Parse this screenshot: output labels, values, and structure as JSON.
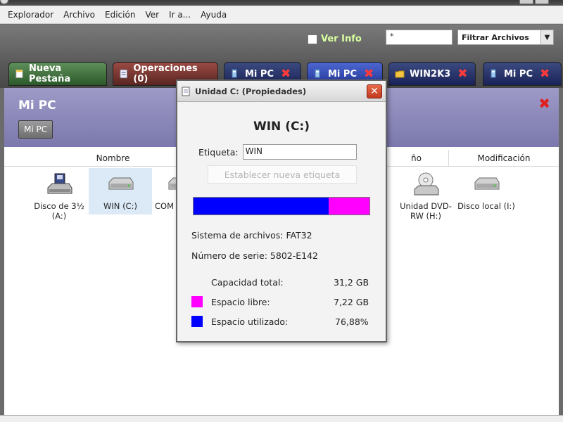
{
  "menu": [
    "Explorador",
    "Archivo",
    "Edición",
    "Ver",
    "Ir a...",
    "Ayuda"
  ],
  "toolbar": {
    "ver_info_label": "Ver Info",
    "search_value": "*",
    "filter_value": "Filtrar Archivos"
  },
  "tabs": [
    {
      "label": "Nueva Pestaña",
      "style": "green",
      "icon": "new-tab-icon"
    },
    {
      "label": "Operaciones (0)",
      "style": "red",
      "icon": "operations-icon"
    },
    {
      "label": "Mi PC",
      "style": "blue",
      "icon": "computer-icon"
    },
    {
      "label": "Mi PC",
      "style": "active",
      "icon": "computer-icon"
    },
    {
      "label": "WIN2K3",
      "style": "blue",
      "icon": "folder-icon"
    },
    {
      "label": "Mi PC",
      "style": "blue",
      "icon": "computer-icon"
    }
  ],
  "panel": {
    "title": "Mi PC",
    "crumb": "Mi PC"
  },
  "columns": {
    "name": "Nombre",
    "size": "ño",
    "modified": "Modificación"
  },
  "drives": [
    {
      "label": "Disco de 3½ (A:)",
      "icon": "floppy-icon"
    },
    {
      "label": "WIN (C:)",
      "icon": "hard-drive-icon"
    },
    {
      "label": "COM",
      "icon": "hard-drive-icon"
    },
    {
      "label": "Unidad DVD-RW (H:)",
      "icon": "dvd-drive-icon"
    },
    {
      "label": "Disco local (I:)",
      "icon": "hard-drive-icon"
    }
  ],
  "dialog": {
    "title": "Unidad C: (Propiedades)",
    "drive_name": "WIN (C:)",
    "label_caption": "Etiqueta:",
    "label_value": "WIN",
    "set_label_button": "Establecer nueva etiqueta",
    "filesystem": "Sistema de archivos: FAT32",
    "serial": "Número de serie: 5802-E142",
    "capacity_label": "Capacidad total:",
    "capacity_value": "31,2 GB",
    "free_label": "Espacio libre:",
    "free_value": "7,22 GB",
    "used_label": "Espacio utilizado:",
    "used_value": "76,88%",
    "used_fraction": 0.7688,
    "colors": {
      "used": "#0000ff",
      "free": "#ff00ff"
    }
  }
}
